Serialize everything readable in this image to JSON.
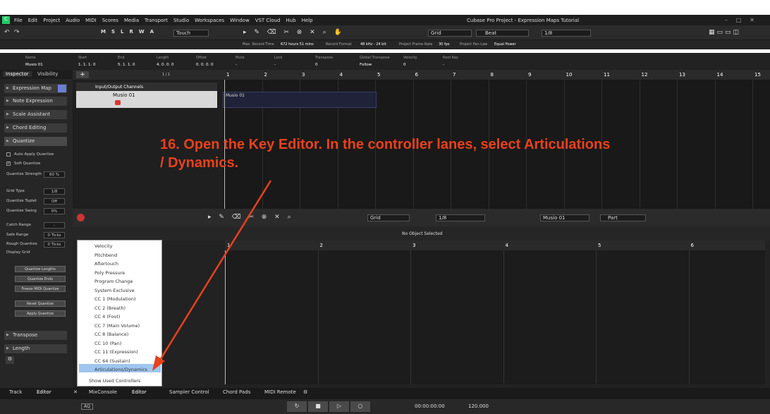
{
  "window": {
    "title": "Cubase Pro Project - Expression Maps Tutorial"
  },
  "menu_items": [
    "File",
    "Edit",
    "Project",
    "Audio",
    "MIDI",
    "Scores",
    "Media",
    "Transport",
    "Studio",
    "Workspaces",
    "Window",
    "VST Cloud",
    "Hub",
    "Help"
  ],
  "toolbar": {
    "automation_mode": "Touch",
    "grid_type": "Grid",
    "grid_mode": "Beat",
    "quantize": "1/8",
    "mrw": [
      "M",
      "S",
      "L",
      "R",
      "W",
      "A"
    ]
  },
  "infoline": {
    "max_record_time_label": "Max. Record Time",
    "max_record_time": "672 hours 51 mins",
    "record_format_label": "Record Format",
    "record_format": "48 kHz - 24 bit",
    "frame_rate_label": "Project Frame Rate",
    "frame_rate": "30 fps",
    "pan_law_label": "Project Pan Law",
    "pan_law": "Equal Power"
  },
  "event_info": {
    "labels": [
      "Name",
      "Start",
      "End",
      "Length",
      "Offset",
      "Mute",
      "Lock",
      "Transpose",
      "Global Transpose",
      "Velocity",
      "Root Key"
    ],
    "values": [
      "Musio 01",
      "1. 1. 1.  0",
      "5. 1. 1.  0",
      "4. 0. 0.  0",
      "0. 0. 0.  0",
      "-",
      "-",
      "0",
      "Follow",
      "0",
      "-"
    ]
  },
  "inspector": {
    "tabs": [
      "Inspector",
      "Visibility"
    ],
    "sections": [
      "Expression Map",
      "Note Expression",
      "Scale Assistant",
      "Chord Editing",
      "Quantize"
    ],
    "auto_apply": "Auto Apply Quantize",
    "soft_quantize": "Soft Quantize",
    "rows": [
      {
        "label": "Quantize Strength",
        "value": "60 %"
      },
      {
        "label": "Grid Type",
        "value": "1/8"
      },
      {
        "label": "Quantize Tuplet",
        "value": "Off"
      },
      {
        "label": "Quantize Swing",
        "value": "0%"
      },
      {
        "label": "Catch Range",
        "value": "-"
      },
      {
        "label": "Safe Range",
        "value": "0 Ticks"
      },
      {
        "label": "Rough Quantize",
        "value": "0 Ticks"
      }
    ],
    "display_grid": "Display Grid",
    "buttons": [
      "Quantize Lengths",
      "Quantize Ends",
      "Freeze MIDI Quantize",
      "Reset Quantize",
      "Apply Quantize"
    ],
    "bottom_sections": [
      "Transpose",
      "Length"
    ]
  },
  "tracks": {
    "count": "1 / 1",
    "folder": "Input/Output Channels",
    "track_name": "Musio 01",
    "event_name": "Musio 01"
  },
  "ruler_top": [
    "1",
    "2",
    "3",
    "4",
    "5",
    "6",
    "7",
    "8",
    "9",
    "10",
    "11",
    "12",
    "13",
    "14",
    "15"
  ],
  "editor": {
    "status": "No Object Selected",
    "grid": "Grid",
    "quantize": "1/8",
    "track": "Musio 01",
    "part": "Part",
    "ruler": [
      "1",
      "2",
      "3",
      "4",
      "5",
      "6"
    ]
  },
  "controller_menu": [
    "Velocity",
    "Pitchbend",
    "Aftertouch",
    "Poly Pressure",
    "Program Change",
    "System Exclusive",
    "CC 1  (Modulation)",
    "CC 2  (Breath)",
    "CC 4  (Foot)",
    "CC 7  (Main Volume)",
    "CC 8  (Balance)",
    "CC 10  (Pan)",
    "CC 11  (Expression)",
    "CC 64  (Sustain)",
    "Articulations/Dynamics",
    "Show Used Controllers"
  ],
  "caption": "16. Open the Key Editor. In the controller lanes, select Articulations / Dynamics.",
  "bottom_tabs": [
    "Track",
    "Editor",
    "MixConsole",
    "Editor",
    "Sampler Control",
    "Chord Pads",
    "MIDI Remote"
  ],
  "transport": {
    "time": "00:00:00:00",
    "tempo": "120.000",
    "aq": "AQ"
  },
  "colors": {
    "accent": "#e8411d",
    "selection": "#9fc6ef",
    "record": "#d33"
  }
}
